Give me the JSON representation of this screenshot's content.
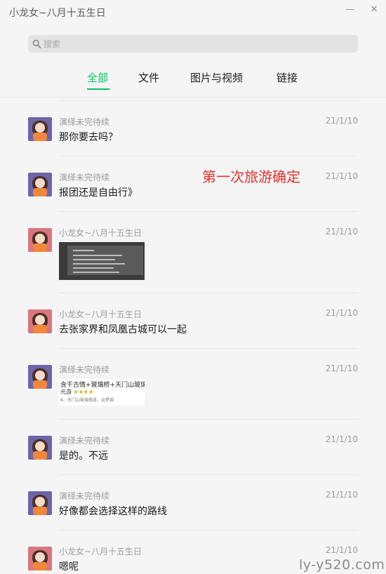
{
  "window": {
    "title": "小龙女~八月十五生日",
    "minimize_glyph": "—",
    "close_glyph": "✕"
  },
  "search": {
    "placeholder": "搜索",
    "icon": "search-icon"
  },
  "tabs": [
    {
      "label": "全部",
      "active": true
    },
    {
      "label": "文件",
      "active": false
    },
    {
      "label": "图片与视频",
      "active": false
    },
    {
      "label": "链接",
      "active": false
    }
  ],
  "colors": {
    "accent": "#07c160",
    "annotation": "#e8302a"
  },
  "messages": [
    {
      "sender": "演绎未完待续",
      "date": "21/1/10",
      "type": "text",
      "text": "那你要去吗？"
    },
    {
      "sender": "演绎未完待续",
      "date": "21/1/10",
      "type": "text",
      "text": "报团还是自由行》"
    },
    {
      "sender": "小龙女~八月十五生日",
      "date": "21/1/10",
      "type": "image",
      "image": "dark-presentation-thumbnail"
    },
    {
      "sender": "小龙女~八月十五生日",
      "date": "21/1/10",
      "type": "text",
      "text": "去张家界和凤凰古城可以一起"
    },
    {
      "sender": "演绎未完待续",
      "date": "21/1/10",
      "type": "image",
      "image_text": {
        "top": "含千古情+玻璃桥+天门山玻璃",
        "sub": "元游",
        "stars": "★★★★",
        "small": "8、天门山玻璃栈道、云梦湖"
      }
    },
    {
      "sender": "演绎未完待续",
      "date": "21/1/10",
      "type": "text",
      "text": "是的。不远"
    },
    {
      "sender": "演绎未完待续",
      "date": "21/1/10",
      "type": "text",
      "text": "好像都会选择这样的路线"
    },
    {
      "sender": "小龙女~八月十五生日",
      "date": "21/1/10",
      "type": "text",
      "text": "嗯呢"
    }
  ],
  "annotation": "第一次旅游确定",
  "watermark": "ly-y520.com"
}
